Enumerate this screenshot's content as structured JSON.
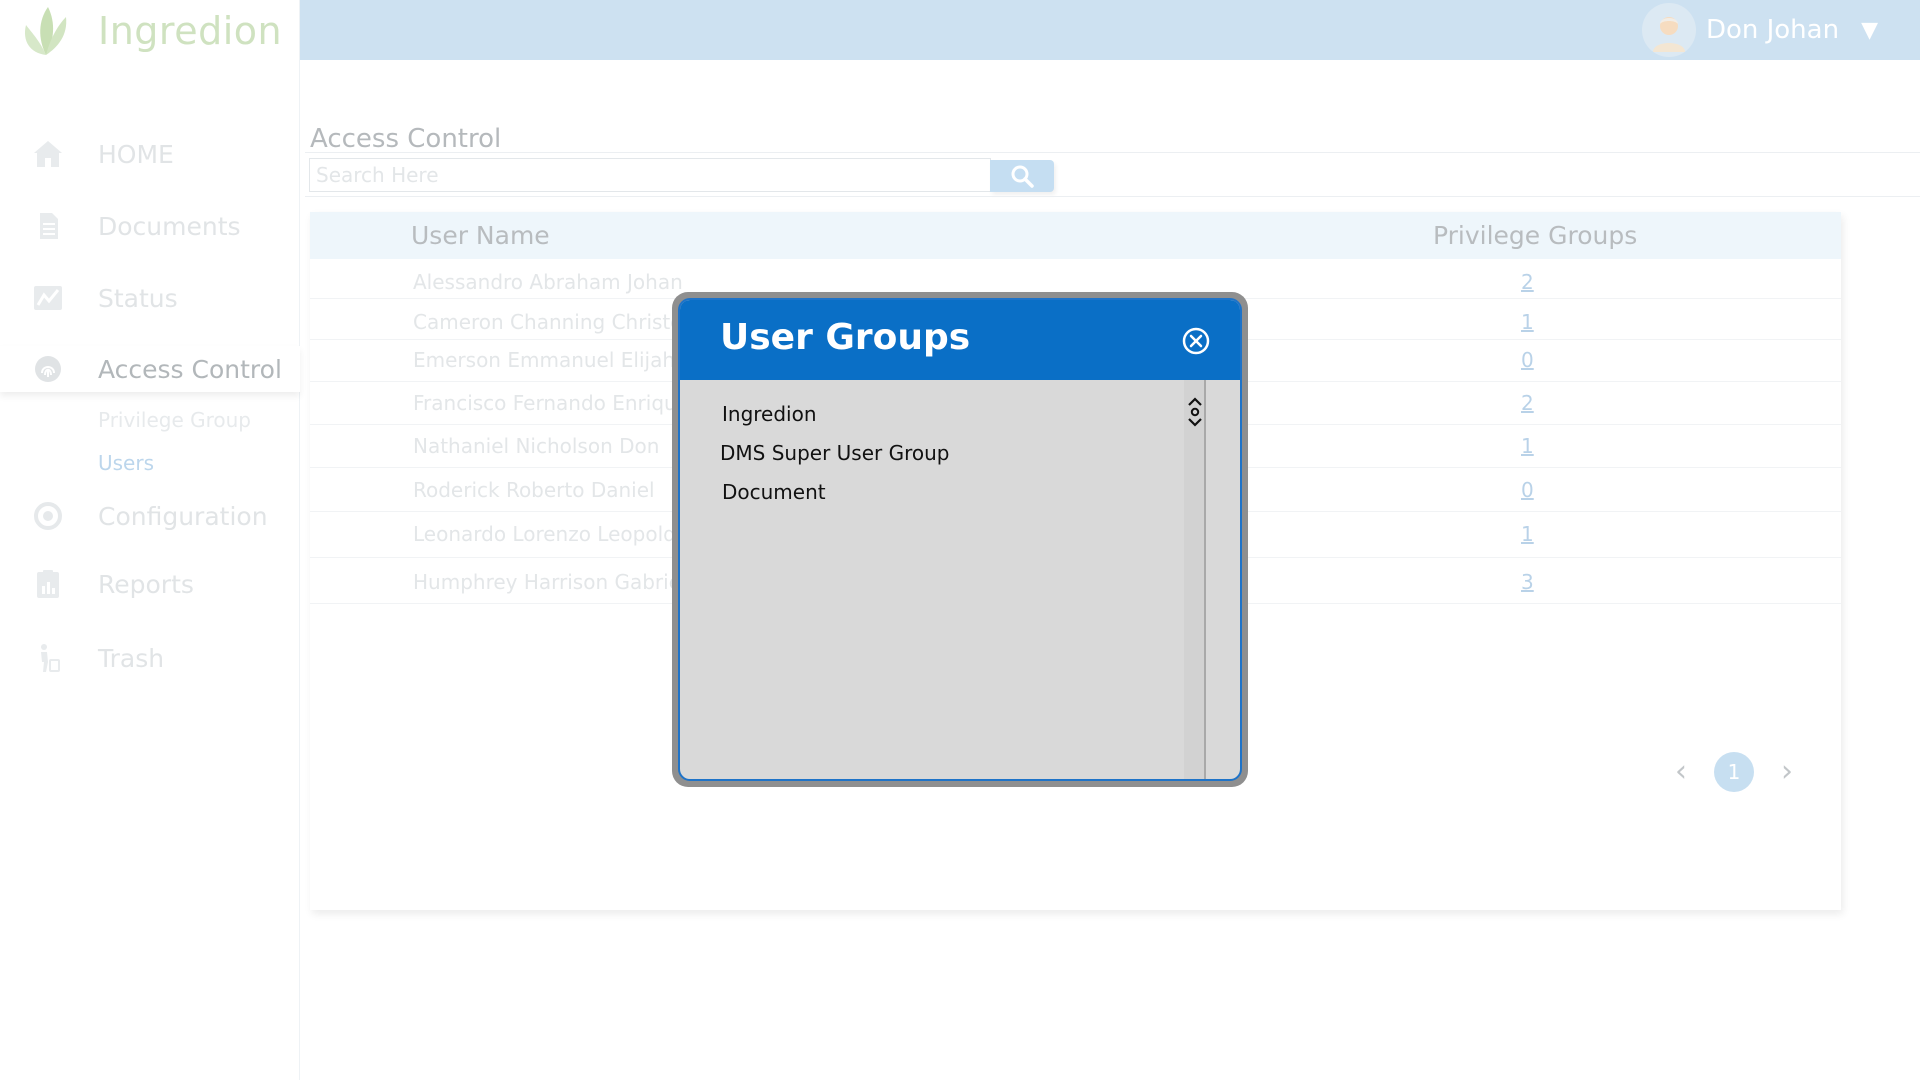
{
  "app": {
    "name": "Ingredion",
    "colors": {
      "brand_green": "#cfe2c0",
      "header_blue": "#cde1f1",
      "modal_blue": "#0a6fc6"
    }
  },
  "header": {
    "user_name": "Don Johan",
    "caret": "▼"
  },
  "nav": {
    "home": "HOME",
    "documents": "Documents",
    "status": "Status",
    "access_control": "Access Control",
    "privilege_group": "Privilege Group",
    "users": "Users",
    "configuration": "Configuration",
    "reports": "Reports",
    "trash": "Trash"
  },
  "main": {
    "title": "Access Control",
    "search_placeholder": "Search Here",
    "columns": {
      "user_name": "User Name",
      "privilege_groups": "Privilege Groups"
    },
    "rows": [
      {
        "name": "Alessandro Abraham Johan",
        "count": "2"
      },
      {
        "name": "Cameron Channing Christop",
        "count": "1"
      },
      {
        "name": "Emerson Emmanuel Elijah",
        "count": "0"
      },
      {
        "name": "Francisco Fernando Enrique",
        "count": "2"
      },
      {
        "name": "Nathaniel Nicholson Don",
        "count": "1"
      },
      {
        "name": "Roderick Roberto Daniel",
        "count": "0"
      },
      {
        "name": "Leonardo Lorenzo Leopold",
        "count": "1"
      },
      {
        "name": "Humphrey Harrison Gabriel",
        "count": "3"
      }
    ],
    "pagination": {
      "prev": "‹",
      "current": "1",
      "next": "›"
    }
  },
  "modal": {
    "title": "User Groups",
    "items": [
      "Ingredion",
      "DMS Super User Group",
      "Document"
    ]
  }
}
